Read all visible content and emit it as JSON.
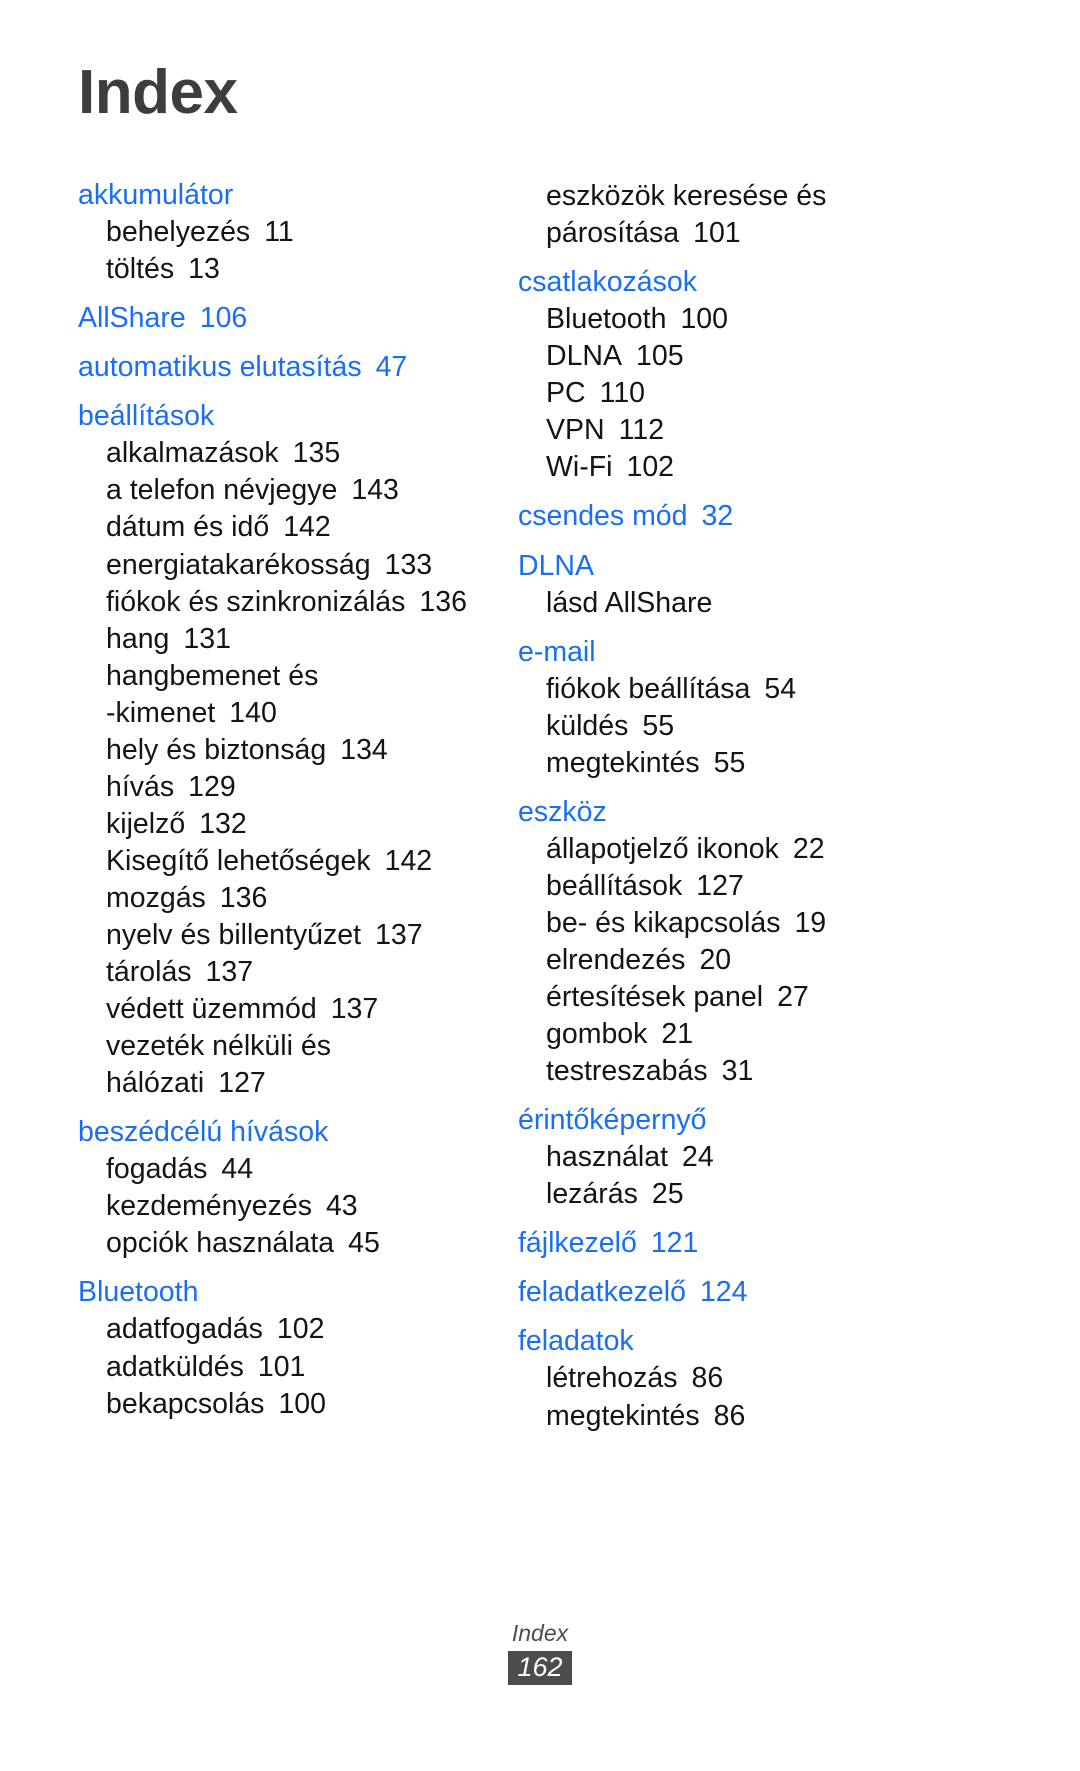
{
  "page": {
    "title": "Index",
    "footer_label": "Index",
    "page_number": "162",
    "heading_color": "#1a6ef5",
    "title_color": "#3d3d3d",
    "body_color": "#141414",
    "footer_box_color": "#4d4d4d"
  },
  "columns": [
    {
      "name": "left-column",
      "entries": [
        {
          "type": "head",
          "label": "akkumulátor",
          "page": ""
        },
        {
          "type": "sub",
          "label": "behelyezés",
          "page": "11"
        },
        {
          "type": "sub",
          "label": "töltés",
          "page": "13"
        },
        {
          "type": "head",
          "label": "AllShare",
          "page": "106"
        },
        {
          "type": "head",
          "label": "automatikus elutasítás",
          "page": "47"
        },
        {
          "type": "head",
          "label": "beállítások",
          "page": ""
        },
        {
          "type": "sub",
          "label": "alkalmazások",
          "page": "135"
        },
        {
          "type": "sub",
          "label": "a telefon névjegye",
          "page": "143"
        },
        {
          "type": "sub",
          "label": "dátum és idő",
          "page": "142"
        },
        {
          "type": "sub",
          "label": "energiatakarékosság",
          "page": "133"
        },
        {
          "type": "sub",
          "label": "fiókok és szinkronizálás",
          "page": "136"
        },
        {
          "type": "sub",
          "label": "hang",
          "page": "131"
        },
        {
          "type": "sub",
          "label": "hangbemenet és",
          "page": ""
        },
        {
          "type": "cont",
          "label": "-kimenet",
          "page": "140"
        },
        {
          "type": "sub",
          "label": "hely és biztonság",
          "page": "134"
        },
        {
          "type": "sub",
          "label": "hívás",
          "page": "129"
        },
        {
          "type": "sub",
          "label": "kijelző",
          "page": "132"
        },
        {
          "type": "sub",
          "label": "Kisegítő lehetőségek",
          "page": "142"
        },
        {
          "type": "sub",
          "label": "mozgás",
          "page": "136"
        },
        {
          "type": "sub",
          "label": "nyelv és billentyűzet",
          "page": "137"
        },
        {
          "type": "sub",
          "label": "tárolás",
          "page": "137"
        },
        {
          "type": "sub",
          "label": "védett üzemmód",
          "page": "137"
        },
        {
          "type": "sub",
          "label": "vezeték nélküli és",
          "page": ""
        },
        {
          "type": "cont",
          "label": "hálózati",
          "page": "127"
        },
        {
          "type": "head",
          "label": "beszédcélú hívások",
          "page": ""
        },
        {
          "type": "sub",
          "label": "fogadás",
          "page": "44"
        },
        {
          "type": "sub",
          "label": "kezdeményezés",
          "page": "43"
        },
        {
          "type": "sub",
          "label": "opciók használata",
          "page": "45"
        },
        {
          "type": "head",
          "label": "Bluetooth",
          "page": ""
        },
        {
          "type": "sub",
          "label": "adatfogadás",
          "page": "102"
        },
        {
          "type": "sub",
          "label": "adatküldés",
          "page": "101"
        },
        {
          "type": "sub",
          "label": "bekapcsolás",
          "page": "100"
        }
      ]
    },
    {
      "name": "right-column",
      "entries": [
        {
          "type": "sub",
          "label": "eszközök keresése és",
          "page": ""
        },
        {
          "type": "cont",
          "label": "párosítása",
          "page": "101"
        },
        {
          "type": "head",
          "label": "csatlakozások",
          "page": ""
        },
        {
          "type": "sub",
          "label": "Bluetooth",
          "page": "100"
        },
        {
          "type": "sub",
          "label": "DLNA",
          "page": "105"
        },
        {
          "type": "sub",
          "label": "PC",
          "page": "110"
        },
        {
          "type": "sub",
          "label": "VPN",
          "page": "112"
        },
        {
          "type": "sub",
          "label": "Wi-Fi",
          "page": "102"
        },
        {
          "type": "head",
          "label": "csendes mód",
          "page": "32"
        },
        {
          "type": "head",
          "label": "DLNA",
          "page": ""
        },
        {
          "type": "sub",
          "label": "lásd AllShare",
          "page": ""
        },
        {
          "type": "head",
          "label": "e-mail",
          "page": ""
        },
        {
          "type": "sub",
          "label": "fiókok beállítása",
          "page": "54"
        },
        {
          "type": "sub",
          "label": "küldés",
          "page": "55"
        },
        {
          "type": "sub",
          "label": "megtekintés",
          "page": "55"
        },
        {
          "type": "head",
          "label": "eszköz",
          "page": ""
        },
        {
          "type": "sub",
          "label": "állapotjelző ikonok",
          "page": "22"
        },
        {
          "type": "sub",
          "label": "beállítások",
          "page": "127"
        },
        {
          "type": "sub",
          "label": "be- és kikapcsolás",
          "page": "19"
        },
        {
          "type": "sub",
          "label": "elrendezés",
          "page": "20"
        },
        {
          "type": "sub",
          "label": "értesítések panel",
          "page": "27"
        },
        {
          "type": "sub",
          "label": "gombok",
          "page": "21"
        },
        {
          "type": "sub",
          "label": "testreszabás",
          "page": "31"
        },
        {
          "type": "head",
          "label": "érintőképernyő",
          "page": ""
        },
        {
          "type": "sub",
          "label": "használat",
          "page": "24"
        },
        {
          "type": "sub",
          "label": "lezárás",
          "page": "25"
        },
        {
          "type": "head",
          "label": "fájlkezelő",
          "page": "121"
        },
        {
          "type": "head",
          "label": "feladatkezelő",
          "page": "124"
        },
        {
          "type": "head",
          "label": "feladatok",
          "page": ""
        },
        {
          "type": "sub",
          "label": "létrehozás",
          "page": "86"
        },
        {
          "type": "sub",
          "label": "megtekintés",
          "page": "86"
        }
      ]
    }
  ]
}
